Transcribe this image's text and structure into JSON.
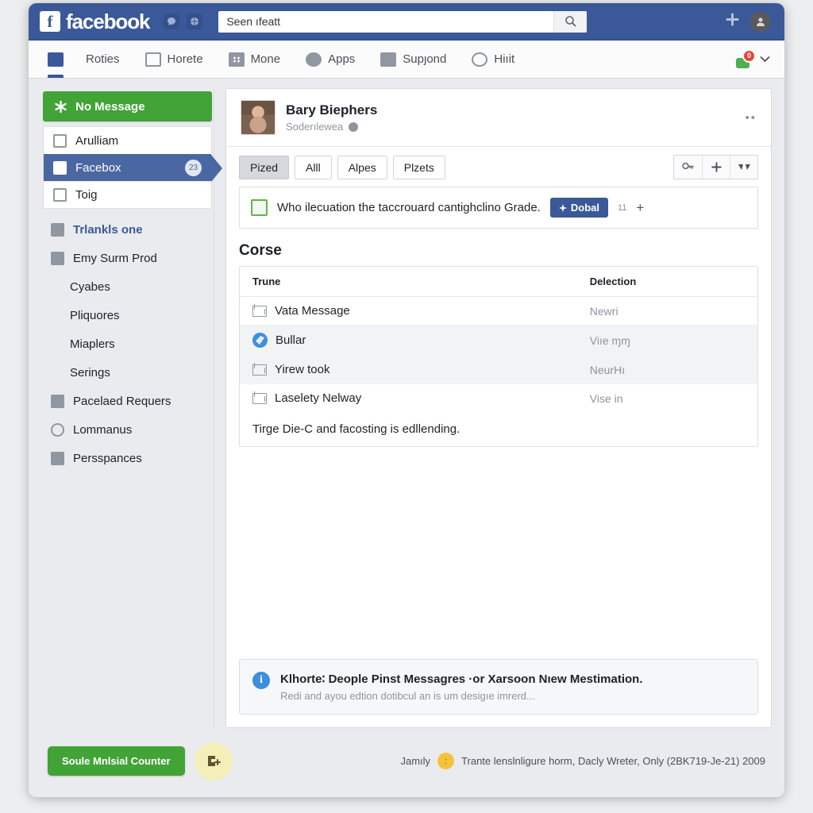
{
  "topbar": {
    "logo_letter": "f",
    "wordmark": "facebook",
    "mini_icons": [
      "chat-icon",
      "globe-icon"
    ],
    "search_value": "Seen ıfeatt",
    "search_placeholder": "Seen ıfeatt",
    "search_button_icon": "search-icon",
    "right_icons": [
      "friend-add-icon",
      "account-avatar-icon"
    ]
  },
  "nav": {
    "items": [
      {
        "label": "",
        "icon": "news-feed-icon",
        "active": true
      },
      {
        "label": "Roties",
        "icon": "",
        "active": false
      },
      {
        "label": "Horete",
        "icon": "home-icon",
        "active": false
      },
      {
        "label": "Mone",
        "icon": "grid-icon",
        "active": false
      },
      {
        "label": "Apps",
        "icon": "apps-icon",
        "active": false
      },
      {
        "label": "Supȷond",
        "icon": "image-icon",
        "active": false
      },
      {
        "label": "Hiıit",
        "icon": "target-icon",
        "active": false
      }
    ],
    "messenger_badge": "0",
    "caret_icon": "chevron-down-icon"
  },
  "sidebar": {
    "primary_button": {
      "label": "No Message",
      "icon": "asterisk-icon"
    },
    "group_items": [
      {
        "label": "Arulliam",
        "icon": "board-icon",
        "selected": false,
        "badge": ""
      },
      {
        "label": "Facebox",
        "icon": "page-icon",
        "selected": true,
        "badge": "23"
      },
      {
        "label": "Toig",
        "icon": "calendar-icon",
        "selected": false,
        "badge": ""
      }
    ],
    "plain_items": [
      {
        "label": "Trlankls one",
        "icon": "card-icon",
        "link": true,
        "indent": false
      },
      {
        "label": "Emy Surm Prod",
        "icon": "network-icon",
        "link": false,
        "indent": false
      },
      {
        "label": "Cyabes",
        "icon": "",
        "link": false,
        "indent": true
      },
      {
        "label": "Pliquores",
        "icon": "",
        "link": false,
        "indent": true
      },
      {
        "label": "Miaplers",
        "icon": "",
        "link": false,
        "indent": true
      },
      {
        "label": "Serings",
        "icon": "",
        "link": false,
        "indent": true
      },
      {
        "label": "Pacelaed Requers",
        "icon": "layers-icon",
        "link": false,
        "indent": false
      },
      {
        "label": "Lommanus",
        "icon": "globe-grid-icon",
        "link": false,
        "indent": false
      },
      {
        "label": "Persspances",
        "icon": "shape-icon",
        "link": false,
        "indent": false
      }
    ]
  },
  "profile": {
    "name": "Bary Biephers",
    "subtitle": "Soderılewea",
    "privacy_icon": "globe-icon",
    "menu_icon": "more-options-icon"
  },
  "tabs": [
    {
      "label": "Pized",
      "active": true
    },
    {
      "label": "Alll",
      "active": false
    },
    {
      "label": "Alpes",
      "active": false
    },
    {
      "label": "Plzets",
      "active": false
    }
  ],
  "toolbar_icons": [
    "key-icon",
    "plus-icon",
    "glasses-icon"
  ],
  "composer": {
    "icon": "chart-icon",
    "text": "Who ilecuation the taccrouard cantighclino Grade.",
    "pill_label": "Dobal",
    "pill_icon": "sparkle-icon",
    "count": "11",
    "plus_icon": "plus-icon"
  },
  "section": {
    "title": "Corse",
    "columns": [
      "Trune",
      "Delection"
    ],
    "rows": [
      {
        "icon": "mail-open-icon",
        "name": "Vata Message",
        "status": "Newri",
        "alt": false
      },
      {
        "icon": "blue-bird-icon",
        "name": "Bullar",
        "status": "Viıe ɱɱ",
        "alt": true
      },
      {
        "icon": "mail-icon",
        "name": "Yirew took",
        "status": "NeurHı",
        "alt": true
      },
      {
        "icon": "mail-open-icon",
        "name": "Laselety Nelway",
        "status": "Vise in",
        "alt": false
      }
    ],
    "footer_note": "Tirge Die-C and facosting is edllending."
  },
  "info_box": {
    "icon": "info-icon",
    "title": "Klhorte∶ Deople Pinst Messagres ·or Xarsoon Nıew Mestimation.",
    "subtitle": "Redi and ayou edtion dotibcul an is um desigıe imrerd..."
  },
  "footer": {
    "green_button": "Soule Mnlsial Counter",
    "fab_icon": "add-contact-icon",
    "note_prefix": "Jamıly",
    "note_emoji": "emoji-icon",
    "note": "Trante lenslnligure horm, Dacly Wreter, Only (2BK719-Je-21) 2009"
  },
  "colors": {
    "brand_blue": "#3b5998",
    "accent_green": "#42a336",
    "selected_blue": "#4b67a1",
    "badge_red": "#e4443c",
    "info_blue": "#3b8fdd"
  }
}
